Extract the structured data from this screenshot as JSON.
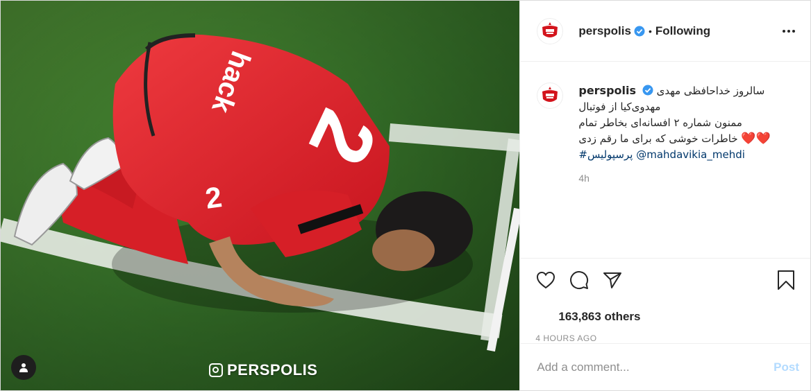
{
  "post": {
    "username": "perspolis",
    "follow_status": "Following",
    "separator": "•",
    "caption": {
      "line1": "سالروز خداحافظی مهدی",
      "line2": "مهدوی‌کیا از فوتبال",
      "line3": "ممنون شماره ۲ افسانه‌ای بخاطر تمام",
      "line4": "خاطرات خوشی که برای ما رقم زدی",
      "hearts": "❤️❤️",
      "mention": "@mahdavikia_mehdi",
      "hashtag": "#پرسپولیس"
    },
    "time_ago": "4h",
    "likes": "163,863 others",
    "timestamp": "4 HOURS AGO",
    "comment_placeholder": "Add a comment...",
    "post_button": "Post",
    "watermark": "PERSPOLIS",
    "jersey_number": "2"
  },
  "icons": {
    "like": "heart-icon",
    "comment": "comment-icon",
    "share": "paper-plane-icon",
    "save": "bookmark-icon",
    "more": "more-options-icon",
    "verified": "verified-badge-icon",
    "tag": "user-tag-icon"
  },
  "colors": {
    "verified": "#3897f0",
    "link": "#00376b",
    "post_button": "#b3dbff",
    "jersey_red": "#e0222b",
    "grass": "#3a7a2c"
  }
}
